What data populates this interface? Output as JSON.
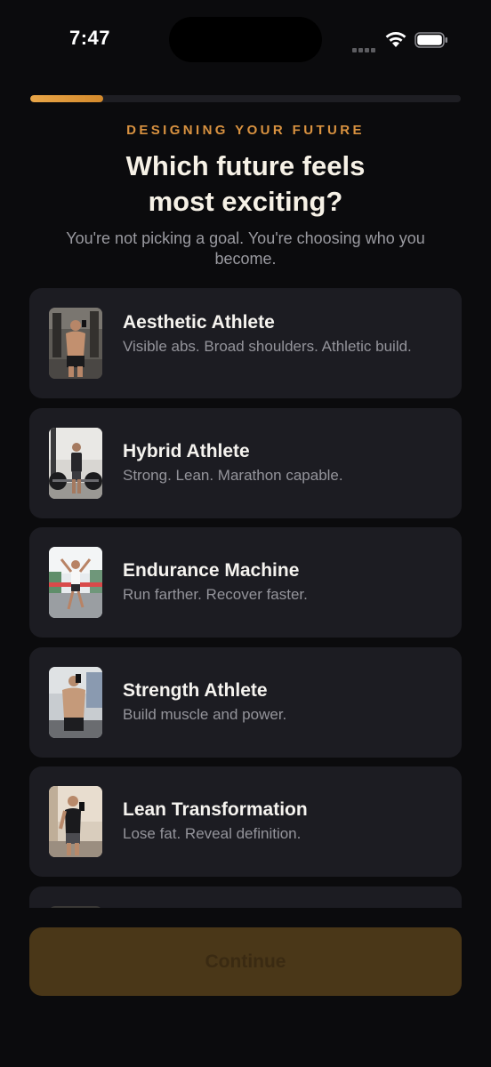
{
  "status_bar": {
    "time": "7:47",
    "icons": [
      "cellular-signal-icon",
      "wifi-icon",
      "battery-icon"
    ]
  },
  "progress": {
    "fraction": 0.17,
    "color": "#e9a648"
  },
  "header": {
    "eyebrow": "DESIGNING YOUR FUTURE",
    "title": "Which future feels\nmost exciting?",
    "subtitle": "You're not picking a goal. You're choosing who you become."
  },
  "options": [
    {
      "title": "Aesthetic Athlete",
      "description": "Visible abs. Broad shoulders. Athletic build.",
      "image_icon": "shirtless-gym-mirror-photo"
    },
    {
      "title": "Hybrid Athlete",
      "description": "Strong. Lean. Marathon capable.",
      "image_icon": "gym-barbell-photo"
    },
    {
      "title": "Endurance Machine",
      "description": "Run farther. Recover faster.",
      "image_icon": "runner-finish-line-photo"
    },
    {
      "title": "Strength Athlete",
      "description": "Build muscle and power.",
      "image_icon": "shirtless-mirror-selfie-photo"
    },
    {
      "title": "Lean Transformation",
      "description": "Lose fat. Reveal definition.",
      "image_icon": "tank-top-mirror-selfie-photo"
    }
  ],
  "continue_button": {
    "label": "Continue",
    "state": "disabled",
    "color": "#4a3718"
  }
}
